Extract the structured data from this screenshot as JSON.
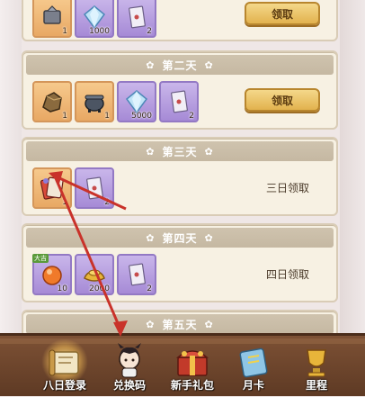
{
  "days": [
    {
      "title": "",
      "items": [
        {
          "icon": "token-icon",
          "frame": "orange",
          "qty": "1"
        },
        {
          "icon": "diamond-icon",
          "frame": "purple",
          "qty": "1000"
        },
        {
          "icon": "ticket-icon",
          "frame": "purple",
          "qty": "2"
        }
      ],
      "action": {
        "type": "button",
        "label": "领取"
      }
    },
    {
      "title": "第二天",
      "items": [
        {
          "icon": "stone-icon",
          "frame": "orange",
          "qty": "1"
        },
        {
          "icon": "cauldron-icon",
          "frame": "orange",
          "qty": "1"
        },
        {
          "icon": "diamond-icon",
          "frame": "purple",
          "qty": "5000"
        },
        {
          "icon": "ticket-icon",
          "frame": "purple",
          "qty": "2"
        }
      ],
      "action": {
        "type": "button",
        "label": "领取"
      }
    },
    {
      "title": "第三天",
      "items": [
        {
          "icon": "card-pack-icon",
          "frame": "orange",
          "qty": "1"
        },
        {
          "icon": "ticket-icon",
          "frame": "purple",
          "qty": "2"
        }
      ],
      "action": {
        "type": "text",
        "label": "三日领取"
      }
    },
    {
      "title": "第四天",
      "items": [
        {
          "icon": "orb-icon",
          "frame": "purple",
          "qty": "10",
          "badge": "大吉"
        },
        {
          "icon": "gold-ingot-icon",
          "frame": "purple",
          "qty": "2000"
        },
        {
          "icon": "ticket-icon",
          "frame": "purple",
          "qty": "2"
        }
      ],
      "action": {
        "type": "text",
        "label": "四日领取"
      }
    },
    {
      "title": "第五天",
      "items": [],
      "action": {
        "type": "none",
        "label": ""
      }
    }
  ],
  "nav": [
    {
      "label": "八日登录",
      "icon": "scroll-icon",
      "active": true
    },
    {
      "label": "兑换码",
      "icon": "character-icon",
      "active": false
    },
    {
      "label": "新手礼包",
      "icon": "gift-chest-icon",
      "active": false
    },
    {
      "label": "月卡",
      "icon": "month-card-icon",
      "active": false
    },
    {
      "label": "里程",
      "icon": "trophy-icon",
      "active": false
    }
  ],
  "colors": {
    "annotation_arrow": "#c9322a",
    "card_bg": "#f7f1e3",
    "header_bg": "#c9bca6",
    "button_gold": "#e2b24e",
    "bottom_bar": "#6b4229"
  }
}
